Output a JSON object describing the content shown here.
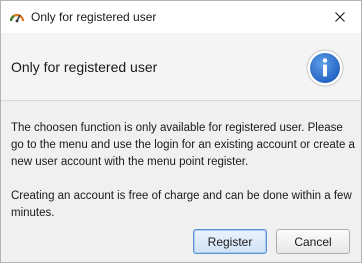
{
  "window": {
    "title": "Only for registered user",
    "app_icon": "gauge-icon",
    "close_icon": "close-icon"
  },
  "header": {
    "title": "Only for registered user",
    "icon": "info-icon",
    "icon_color": "#2a6fd6"
  },
  "message": {
    "paragraph1": "The choosen function is only available for registered user. Please go to the menu and use the login for an existing account or create a new user account with the menu point register.",
    "paragraph2": "Creating an account is free of charge and can be done within a few minutes."
  },
  "buttons": {
    "register_label": "Register",
    "cancel_label": "Cancel"
  }
}
